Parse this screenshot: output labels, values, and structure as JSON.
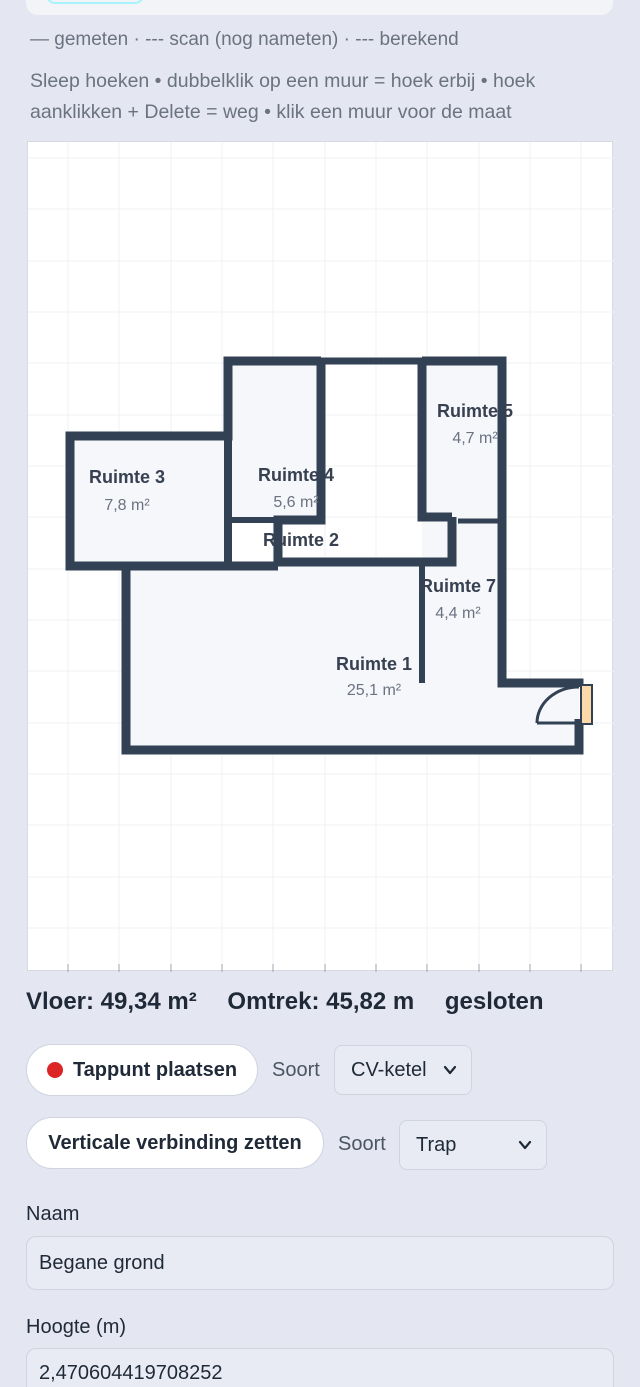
{
  "help": {
    "legend": "— gemeten · --- scan (nog nameten) · --- berekend",
    "hint": "Sleep hoeken • dubbelklik op een muur = hoek erbij • hoek aanklikken + Delete = weg • klik een muur voor de maat"
  },
  "rooms": [
    {
      "name": "Ruimte 1",
      "area": "25,1 m²"
    },
    {
      "name": "Ruimte 2",
      "area": ""
    },
    {
      "name": "Ruimte 3",
      "area": "7,8 m²"
    },
    {
      "name": "Ruimte 4",
      "area": "5,6 m²"
    },
    {
      "name": "Ruimte 5",
      "area": "4,7 m²"
    },
    {
      "name": "Ruimte 7",
      "area": "4,4 m²"
    }
  ],
  "stats": {
    "floor": "Vloer: 49,34 m²",
    "perimeter": "Omtrek: 45,82 m",
    "status": "gesloten"
  },
  "tappunt": {
    "button_label": "Tappunt plaatsen",
    "soort_label": "Soort",
    "soort_value": "CV-ketel"
  },
  "verbinding": {
    "button_label": "Verticale verbinding zetten",
    "soort_label": "Soort",
    "soort_value": "Trap"
  },
  "form": {
    "name_label": "Naam",
    "name_value": "Begane grond",
    "height_label": "Hoogte (m)",
    "height_value": "2,470604419708252"
  },
  "colors": {
    "wall": "#334155",
    "room_fill": "#f5f7fb",
    "door_leaf": "#fcd9a8",
    "tappunt_dot": "#dc2626",
    "cyan_accent": "#a5f3fc"
  }
}
